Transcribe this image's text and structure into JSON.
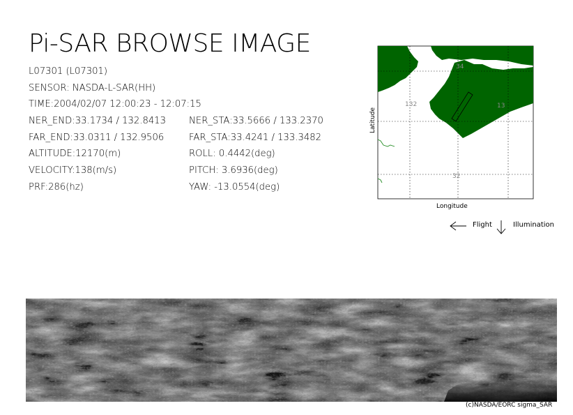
{
  "header": {
    "title": "Pi-SAR BROWSE IMAGE"
  },
  "info": {
    "scene_id": "L07301 (L07301)",
    "sensor": "SENSOR: NASDA-L-SAR(HH)",
    "time": "TIME:2004/02/07  12:00:23 - 12:07:15",
    "ner_end": "NER_END:33.1734 / 132.8413",
    "far_end": "FAR_END:33.0311 / 132.9506",
    "altitude": "ALTITUDE:12170(m)",
    "velocity": "VELOCITY:138(m/s)",
    "prf": "PRF:286(hz)",
    "ner_sta": "NER_STA:33.5666 / 133.2370",
    "far_sta": "FAR_STA:33.4241 / 133.3482",
    "roll": "ROLL: 0.4442(deg)",
    "pitch": "PITCH:  3.6936(deg)",
    "yaw": "YAW: -13.0554(deg)"
  },
  "map": {
    "x_axis_label": "Longitude",
    "y_axis_label": "Latitude",
    "grid_labels": {
      "lon_132": "132",
      "lon_133": "13",
      "lat_32": "32",
      "lat_34": "34"
    },
    "land_color": "#006400",
    "coast_color": "#228b22"
  },
  "legend": {
    "flight_label": "Flight",
    "illumination_label": "Illumination",
    "flight_icon": "arrow-left-icon",
    "illumination_icon": "arrow-down-icon"
  },
  "footer": {
    "copyright": "(c)NASDA/EORC sigma_SAR"
  }
}
